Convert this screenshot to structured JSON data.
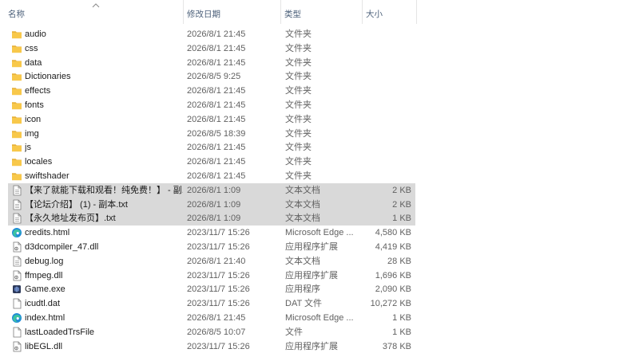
{
  "columns": {
    "name": "名称",
    "date": "修改日期",
    "type": "类型",
    "size": "大小"
  },
  "files": [
    {
      "name": "audio",
      "date": "2026/8/1 21:45",
      "type": "文件夹",
      "size": "",
      "icon": "folder-icon",
      "selected": false
    },
    {
      "name": "css",
      "date": "2026/8/1 21:45",
      "type": "文件夹",
      "size": "",
      "icon": "folder-icon",
      "selected": false
    },
    {
      "name": "data",
      "date": "2026/8/1 21:45",
      "type": "文件夹",
      "size": "",
      "icon": "folder-icon",
      "selected": false
    },
    {
      "name": "Dictionaries",
      "date": "2026/8/5 9:25",
      "type": "文件夹",
      "size": "",
      "icon": "folder-icon",
      "selected": false
    },
    {
      "name": "effects",
      "date": "2026/8/1 21:45",
      "type": "文件夹",
      "size": "",
      "icon": "folder-icon",
      "selected": false
    },
    {
      "name": "fonts",
      "date": "2026/8/1 21:45",
      "type": "文件夹",
      "size": "",
      "icon": "folder-icon",
      "selected": false
    },
    {
      "name": "icon",
      "date": "2026/8/1 21:45",
      "type": "文件夹",
      "size": "",
      "icon": "folder-icon",
      "selected": false
    },
    {
      "name": "img",
      "date": "2026/8/5 18:39",
      "type": "文件夹",
      "size": "",
      "icon": "folder-icon",
      "selected": false
    },
    {
      "name": "js",
      "date": "2026/8/1 21:45",
      "type": "文件夹",
      "size": "",
      "icon": "folder-icon",
      "selected": false
    },
    {
      "name": "locales",
      "date": "2026/8/1 21:45",
      "type": "文件夹",
      "size": "",
      "icon": "folder-icon",
      "selected": false
    },
    {
      "name": "swiftshader",
      "date": "2026/8/1 21:45",
      "type": "文件夹",
      "size": "",
      "icon": "folder-icon",
      "selected": false
    },
    {
      "name": "【来了就能下载和观看！纯免费！】 - 副...",
      "date": "2026/8/1 1:09",
      "type": "文本文档",
      "size": "2 KB",
      "icon": "text-file-icon",
      "selected": true
    },
    {
      "name": "【论坛介绍】 (1) - 副本.txt",
      "date": "2026/8/1 1:09",
      "type": "文本文档",
      "size": "2 KB",
      "icon": "text-file-icon",
      "selected": true
    },
    {
      "name": "【永久地址发布页】.txt",
      "date": "2026/8/1 1:09",
      "type": "文本文档",
      "size": "1 KB",
      "icon": "text-file-icon",
      "selected": true
    },
    {
      "name": "credits.html",
      "date": "2023/11/7 15:26",
      "type": "Microsoft Edge ...",
      "size": "4,580 KB",
      "icon": "edge-icon",
      "selected": false
    },
    {
      "name": "d3dcompiler_47.dll",
      "date": "2023/11/7 15:26",
      "type": "应用程序扩展",
      "size": "4,419 KB",
      "icon": "dll-file-icon",
      "selected": false
    },
    {
      "name": "debug.log",
      "date": "2026/8/1 21:40",
      "type": "文本文档",
      "size": "28 KB",
      "icon": "text-file-icon",
      "selected": false
    },
    {
      "name": "ffmpeg.dll",
      "date": "2023/11/7 15:26",
      "type": "应用程序扩展",
      "size": "1,696 KB",
      "icon": "dll-file-icon",
      "selected": false
    },
    {
      "name": "Game.exe",
      "date": "2023/11/7 15:26",
      "type": "应用程序",
      "size": "2,090 KB",
      "icon": "game-exe-icon",
      "selected": false
    },
    {
      "name": "icudtl.dat",
      "date": "2023/11/7 15:26",
      "type": "DAT 文件",
      "size": "10,272 KB",
      "icon": "blank-file-icon",
      "selected": false
    },
    {
      "name": "index.html",
      "date": "2026/8/1 21:45",
      "type": "Microsoft Edge ...",
      "size": "1 KB",
      "icon": "edge-icon",
      "selected": false
    },
    {
      "name": "lastLoadedTrsFile",
      "date": "2026/8/5 10:07",
      "type": "文件",
      "size": "1 KB",
      "icon": "blank-file-icon",
      "selected": false
    },
    {
      "name": "libEGL.dll",
      "date": "2023/11/7 15:26",
      "type": "应用程序扩展",
      "size": "378 KB",
      "icon": "dll-file-icon",
      "selected": false
    }
  ],
  "colors": {
    "folder": "#f8c84a",
    "selected_bg": "#d9d9d9",
    "header_text": "#4c607a",
    "secondary_text": "#616161"
  }
}
